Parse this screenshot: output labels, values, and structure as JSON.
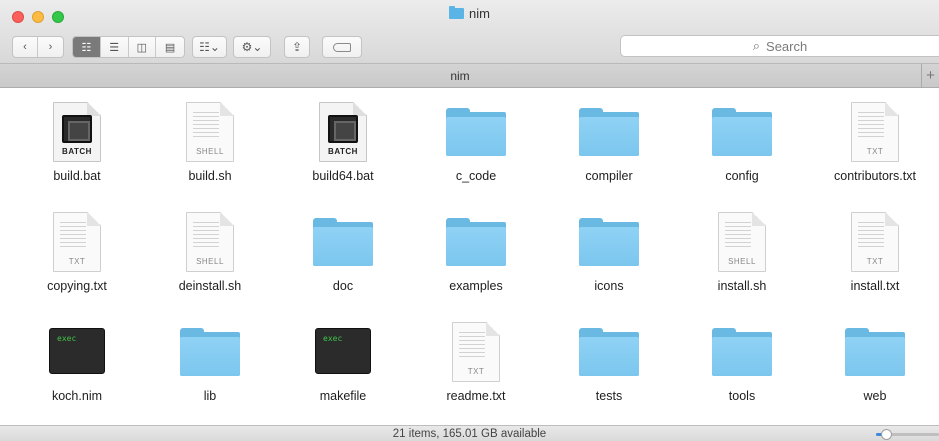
{
  "window": {
    "title": "nim"
  },
  "toolbar": {
    "back_icon": "chevron-left-icon",
    "forward_icon": "chevron-right-icon",
    "view_modes": [
      "icon-view",
      "list-view",
      "column-view",
      "cover-flow-view"
    ],
    "active_view": "icon-view",
    "search_placeholder": "Search"
  },
  "pathbar": {
    "title": "nim",
    "add_tab": "+"
  },
  "files": [
    {
      "name": "build.bat",
      "type": "batch",
      "kind": "BATCH"
    },
    {
      "name": "build.sh",
      "type": "doc",
      "kind": "SHELL"
    },
    {
      "name": "build64.bat",
      "type": "batch",
      "kind": "BATCH"
    },
    {
      "name": "c_code",
      "type": "folder"
    },
    {
      "name": "compiler",
      "type": "folder"
    },
    {
      "name": "config",
      "type": "folder"
    },
    {
      "name": "contributors.txt",
      "type": "doc",
      "kind": "TXT"
    },
    {
      "name": "copying.txt",
      "type": "doc",
      "kind": "TXT"
    },
    {
      "name": "deinstall.sh",
      "type": "doc",
      "kind": "SHELL"
    },
    {
      "name": "doc",
      "type": "folder"
    },
    {
      "name": "examples",
      "type": "folder"
    },
    {
      "name": "icons",
      "type": "folder"
    },
    {
      "name": "install.sh",
      "type": "doc",
      "kind": "SHELL"
    },
    {
      "name": "install.txt",
      "type": "doc",
      "kind": "TXT"
    },
    {
      "name": "koch.nim",
      "type": "exec",
      "kind": "exec"
    },
    {
      "name": "lib",
      "type": "folder"
    },
    {
      "name": "makefile",
      "type": "exec",
      "kind": "exec"
    },
    {
      "name": "readme.txt",
      "type": "doc",
      "kind": "TXT"
    },
    {
      "name": "tests",
      "type": "folder"
    },
    {
      "name": "tools",
      "type": "folder"
    },
    {
      "name": "web",
      "type": "folder"
    }
  ],
  "status": {
    "text": "21 items, 165.01 GB available",
    "zoom_fraction": 0.12
  },
  "colors": {
    "folder": "#7cc6ee",
    "accent": "#3e88e2"
  }
}
